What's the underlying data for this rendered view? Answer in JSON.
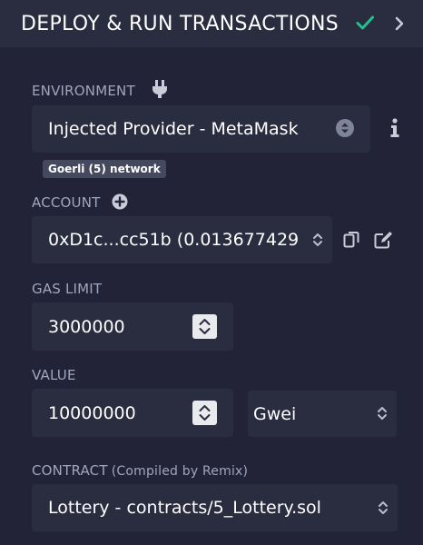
{
  "header": {
    "title": "DEPLOY & RUN TRANSACTIONS"
  },
  "environment": {
    "label": "ENVIRONMENT",
    "selected": "Injected Provider - MetaMask",
    "network_badge": "Goerli (5) network"
  },
  "account": {
    "label": "ACCOUNT",
    "selected": "0xD1c...cc51b (0.013677429"
  },
  "gas_limit": {
    "label": "GAS LIMIT",
    "value": "3000000"
  },
  "value": {
    "label": "VALUE",
    "amount": "10000000",
    "unit": "Gwei"
  },
  "contract": {
    "label": "CONTRACT",
    "sublabel": "(Compiled by Remix)",
    "selected": "Lottery - contracts/5_Lottery.sol"
  },
  "colors": {
    "background": "#222336",
    "panel": "#2a2c3f",
    "accent_check": "#1fc38e",
    "label": "#a1a6bd"
  },
  "icons": [
    "check-icon",
    "chevron-right-icon",
    "plug-icon",
    "info-icon",
    "plus-circle-icon",
    "copy-icon",
    "edit-icon"
  ]
}
